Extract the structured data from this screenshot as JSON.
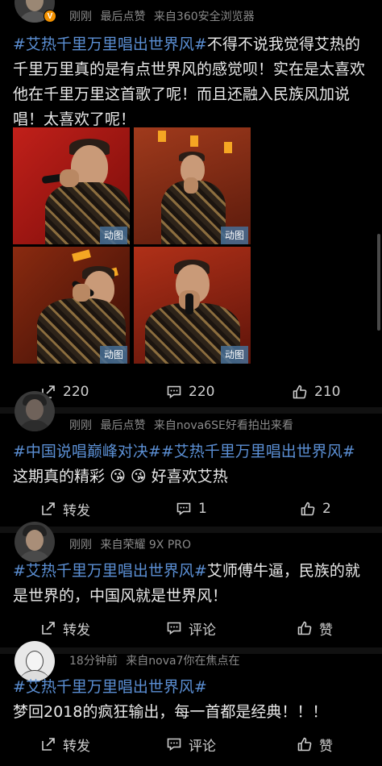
{
  "post1": {
    "meta_time": "刚刚",
    "meta_liked": "最后点赞",
    "meta_source": "来自360安全浏览器",
    "topic": "#艾热千里万里唱出世界风#",
    "text": "不得不说我觉得艾热的千里万里真的是有点世界风的感觉呗！实在是太喜欢他在千里万里这首歌了呢！而且还融入民族风加说唱！太喜欢了呢！",
    "gif_label": "动图",
    "repost_count": "220",
    "comment_count": "220",
    "like_count": "210"
  },
  "post2": {
    "meta_time": "刚刚",
    "meta_liked": "最后点赞",
    "meta_source": "来自nova6SE好看拍出来看",
    "topic": "#中国说唱巅峰对决##艾热千里万里唱出世界风#",
    "text": "这期真的精彩",
    "text_tail": "好喜欢艾热",
    "emoji": "😘",
    "repost_label": "转发",
    "comment_count": "1",
    "like_count": "2"
  },
  "post3": {
    "meta_time": "刚刚",
    "meta_source": "来自荣耀 9X PRO",
    "topic": "#艾热千里万里唱出世界风#",
    "text": "艾师傅牛逼，民族的就是世界的，中国风就是世界风！",
    "repost_label": "转发",
    "comment_label": "评论",
    "like_label": "赞"
  },
  "post4": {
    "meta_time": "18分钟前",
    "meta_source": "来自nova7你在焦点在",
    "topic": "#艾热千里万里唱出世界风#",
    "text": "梦回2018的疯狂输出，每一首都是经典！！！",
    "repost_label": "转发",
    "comment_label": "评论",
    "like_label": "赞"
  },
  "colors": {
    "topic": "#5b8fd4",
    "text": "#e8e8e8",
    "meta": "#8a8a8a",
    "verified_badge": "#f29100"
  },
  "icons": {
    "repost": "repost-icon",
    "comment": "comment-icon",
    "like": "like-icon"
  }
}
